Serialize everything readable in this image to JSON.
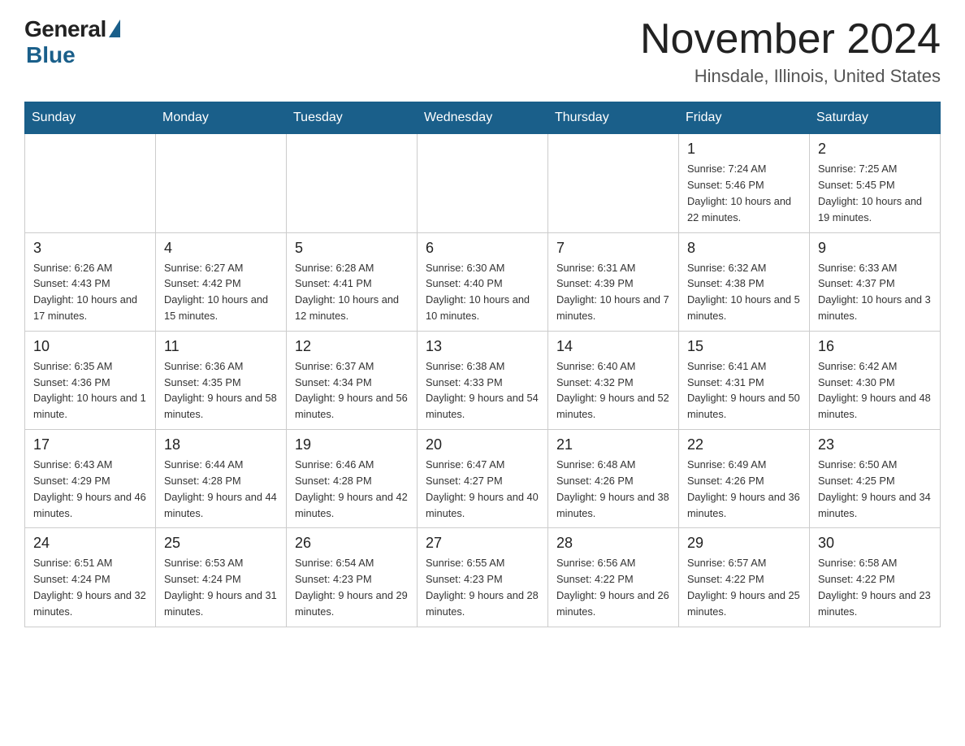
{
  "header": {
    "logo_general": "General",
    "logo_blue": "Blue",
    "month_title": "November 2024",
    "subtitle": "Hinsdale, Illinois, United States"
  },
  "weekdays": [
    "Sunday",
    "Monday",
    "Tuesday",
    "Wednesday",
    "Thursday",
    "Friday",
    "Saturday"
  ],
  "weeks": [
    [
      {
        "day": "",
        "sunrise": "",
        "sunset": "",
        "daylight": ""
      },
      {
        "day": "",
        "sunrise": "",
        "sunset": "",
        "daylight": ""
      },
      {
        "day": "",
        "sunrise": "",
        "sunset": "",
        "daylight": ""
      },
      {
        "day": "",
        "sunrise": "",
        "sunset": "",
        "daylight": ""
      },
      {
        "day": "",
        "sunrise": "",
        "sunset": "",
        "daylight": ""
      },
      {
        "day": "1",
        "sunrise": "Sunrise: 7:24 AM",
        "sunset": "Sunset: 5:46 PM",
        "daylight": "Daylight: 10 hours and 22 minutes."
      },
      {
        "day": "2",
        "sunrise": "Sunrise: 7:25 AM",
        "sunset": "Sunset: 5:45 PM",
        "daylight": "Daylight: 10 hours and 19 minutes."
      }
    ],
    [
      {
        "day": "3",
        "sunrise": "Sunrise: 6:26 AM",
        "sunset": "Sunset: 4:43 PM",
        "daylight": "Daylight: 10 hours and 17 minutes."
      },
      {
        "day": "4",
        "sunrise": "Sunrise: 6:27 AM",
        "sunset": "Sunset: 4:42 PM",
        "daylight": "Daylight: 10 hours and 15 minutes."
      },
      {
        "day": "5",
        "sunrise": "Sunrise: 6:28 AM",
        "sunset": "Sunset: 4:41 PM",
        "daylight": "Daylight: 10 hours and 12 minutes."
      },
      {
        "day": "6",
        "sunrise": "Sunrise: 6:30 AM",
        "sunset": "Sunset: 4:40 PM",
        "daylight": "Daylight: 10 hours and 10 minutes."
      },
      {
        "day": "7",
        "sunrise": "Sunrise: 6:31 AM",
        "sunset": "Sunset: 4:39 PM",
        "daylight": "Daylight: 10 hours and 7 minutes."
      },
      {
        "day": "8",
        "sunrise": "Sunrise: 6:32 AM",
        "sunset": "Sunset: 4:38 PM",
        "daylight": "Daylight: 10 hours and 5 minutes."
      },
      {
        "day": "9",
        "sunrise": "Sunrise: 6:33 AM",
        "sunset": "Sunset: 4:37 PM",
        "daylight": "Daylight: 10 hours and 3 minutes."
      }
    ],
    [
      {
        "day": "10",
        "sunrise": "Sunrise: 6:35 AM",
        "sunset": "Sunset: 4:36 PM",
        "daylight": "Daylight: 10 hours and 1 minute."
      },
      {
        "day": "11",
        "sunrise": "Sunrise: 6:36 AM",
        "sunset": "Sunset: 4:35 PM",
        "daylight": "Daylight: 9 hours and 58 minutes."
      },
      {
        "day": "12",
        "sunrise": "Sunrise: 6:37 AM",
        "sunset": "Sunset: 4:34 PM",
        "daylight": "Daylight: 9 hours and 56 minutes."
      },
      {
        "day": "13",
        "sunrise": "Sunrise: 6:38 AM",
        "sunset": "Sunset: 4:33 PM",
        "daylight": "Daylight: 9 hours and 54 minutes."
      },
      {
        "day": "14",
        "sunrise": "Sunrise: 6:40 AM",
        "sunset": "Sunset: 4:32 PM",
        "daylight": "Daylight: 9 hours and 52 minutes."
      },
      {
        "day": "15",
        "sunrise": "Sunrise: 6:41 AM",
        "sunset": "Sunset: 4:31 PM",
        "daylight": "Daylight: 9 hours and 50 minutes."
      },
      {
        "day": "16",
        "sunrise": "Sunrise: 6:42 AM",
        "sunset": "Sunset: 4:30 PM",
        "daylight": "Daylight: 9 hours and 48 minutes."
      }
    ],
    [
      {
        "day": "17",
        "sunrise": "Sunrise: 6:43 AM",
        "sunset": "Sunset: 4:29 PM",
        "daylight": "Daylight: 9 hours and 46 minutes."
      },
      {
        "day": "18",
        "sunrise": "Sunrise: 6:44 AM",
        "sunset": "Sunset: 4:28 PM",
        "daylight": "Daylight: 9 hours and 44 minutes."
      },
      {
        "day": "19",
        "sunrise": "Sunrise: 6:46 AM",
        "sunset": "Sunset: 4:28 PM",
        "daylight": "Daylight: 9 hours and 42 minutes."
      },
      {
        "day": "20",
        "sunrise": "Sunrise: 6:47 AM",
        "sunset": "Sunset: 4:27 PM",
        "daylight": "Daylight: 9 hours and 40 minutes."
      },
      {
        "day": "21",
        "sunrise": "Sunrise: 6:48 AM",
        "sunset": "Sunset: 4:26 PM",
        "daylight": "Daylight: 9 hours and 38 minutes."
      },
      {
        "day": "22",
        "sunrise": "Sunrise: 6:49 AM",
        "sunset": "Sunset: 4:26 PM",
        "daylight": "Daylight: 9 hours and 36 minutes."
      },
      {
        "day": "23",
        "sunrise": "Sunrise: 6:50 AM",
        "sunset": "Sunset: 4:25 PM",
        "daylight": "Daylight: 9 hours and 34 minutes."
      }
    ],
    [
      {
        "day": "24",
        "sunrise": "Sunrise: 6:51 AM",
        "sunset": "Sunset: 4:24 PM",
        "daylight": "Daylight: 9 hours and 32 minutes."
      },
      {
        "day": "25",
        "sunrise": "Sunrise: 6:53 AM",
        "sunset": "Sunset: 4:24 PM",
        "daylight": "Daylight: 9 hours and 31 minutes."
      },
      {
        "day": "26",
        "sunrise": "Sunrise: 6:54 AM",
        "sunset": "Sunset: 4:23 PM",
        "daylight": "Daylight: 9 hours and 29 minutes."
      },
      {
        "day": "27",
        "sunrise": "Sunrise: 6:55 AM",
        "sunset": "Sunset: 4:23 PM",
        "daylight": "Daylight: 9 hours and 28 minutes."
      },
      {
        "day": "28",
        "sunrise": "Sunrise: 6:56 AM",
        "sunset": "Sunset: 4:22 PM",
        "daylight": "Daylight: 9 hours and 26 minutes."
      },
      {
        "day": "29",
        "sunrise": "Sunrise: 6:57 AM",
        "sunset": "Sunset: 4:22 PM",
        "daylight": "Daylight: 9 hours and 25 minutes."
      },
      {
        "day": "30",
        "sunrise": "Sunrise: 6:58 AM",
        "sunset": "Sunset: 4:22 PM",
        "daylight": "Daylight: 9 hours and 23 minutes."
      }
    ]
  ]
}
